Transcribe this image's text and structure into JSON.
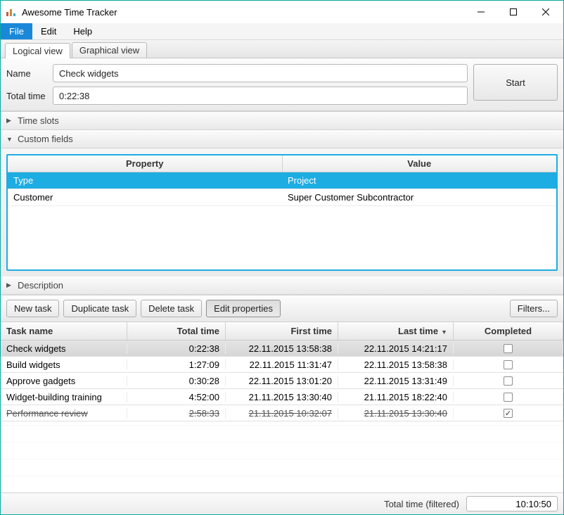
{
  "window": {
    "title": "Awesome Time Tracker"
  },
  "menu": {
    "file": "File",
    "edit": "Edit",
    "help": "Help"
  },
  "tabs": {
    "logical": "Logical view",
    "graphical": "Graphical view"
  },
  "form": {
    "name_label": "Name",
    "name_value": "Check widgets",
    "totaltime_label": "Total time",
    "totaltime_value": "0:22:38",
    "start_label": "Start"
  },
  "accordion": {
    "time_slots": "Time slots",
    "custom_fields": "Custom fields",
    "description": "Description"
  },
  "customfields": {
    "col_property": "Property",
    "col_value": "Value",
    "rows": [
      {
        "property": "Type",
        "value": "Project"
      },
      {
        "property": "Customer",
        "value": "Super Customer Subcontractor"
      }
    ]
  },
  "toolbar": {
    "new_task": "New task",
    "duplicate_task": "Duplicate task",
    "delete_task": "Delete task",
    "edit_properties": "Edit properties",
    "filters": "Filters..."
  },
  "grid": {
    "cols": {
      "task_name": "Task name",
      "total_time": "Total time",
      "first_time": "First time",
      "last_time": "Last time",
      "completed": "Completed"
    },
    "rows": [
      {
        "name": "Check widgets",
        "total": "0:22:38",
        "first": "22.11.2015 13:58:38",
        "last": "22.11.2015 14:21:17",
        "completed": false,
        "selected": true,
        "striked": false
      },
      {
        "name": "Build widgets",
        "total": "1:27:09",
        "first": "22.11.2015 11:31:47",
        "last": "22.11.2015 13:58:38",
        "completed": false,
        "selected": false,
        "striked": false
      },
      {
        "name": "Approve gadgets",
        "total": "0:30:28",
        "first": "22.11.2015 13:01:20",
        "last": "22.11.2015 13:31:49",
        "completed": false,
        "selected": false,
        "striked": false
      },
      {
        "name": "Widget-building training",
        "total": "4:52:00",
        "first": "21.11.2015 13:30:40",
        "last": "21.11.2015 18:22:40",
        "completed": false,
        "selected": false,
        "striked": false
      },
      {
        "name": "Performance review",
        "total": "2:58:33",
        "first": "21.11.2015 10:32:07",
        "last": "21.11.2015 13:30:40",
        "completed": true,
        "selected": false,
        "striked": true
      }
    ]
  },
  "footer": {
    "label": "Total time (filtered)",
    "value": "10:10:50"
  }
}
